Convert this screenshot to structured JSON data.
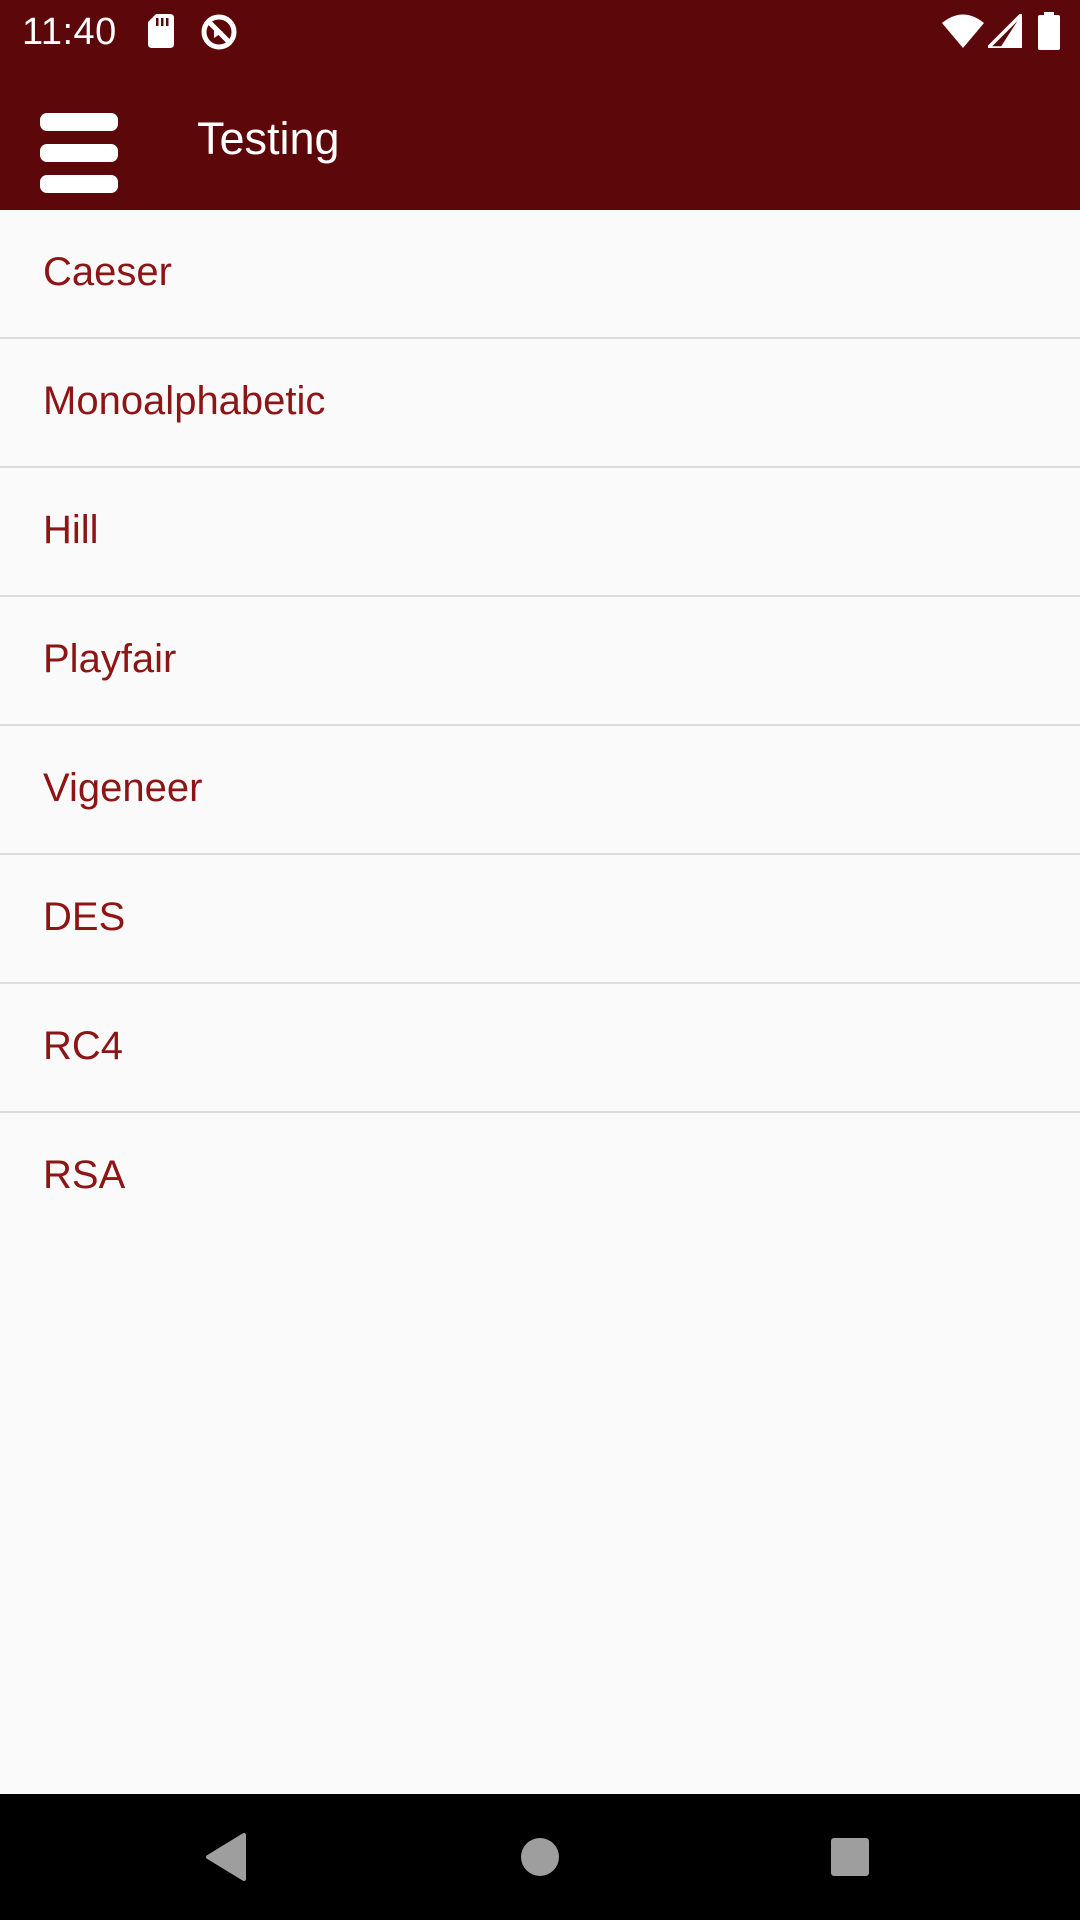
{
  "status_bar": {
    "time": "11:40",
    "icons": [
      "sd-card-icon",
      "sync-disabled-icon",
      "wifi-icon",
      "signal-icon",
      "battery-icon"
    ]
  },
  "app_bar": {
    "title": "Testing",
    "menu_icon": "hamburger-menu-icon",
    "background_color": "#5c080b"
  },
  "list": {
    "items": [
      {
        "label": "Caeser"
      },
      {
        "label": "Monoalphabetic"
      },
      {
        "label": "Hill"
      },
      {
        "label": "Playfair"
      },
      {
        "label": "Vigeneer"
      },
      {
        "label": "DES"
      },
      {
        "label": "RC4"
      },
      {
        "label": "RSA"
      }
    ],
    "text_color": "#8e1515"
  },
  "nav_bar": {
    "icons": [
      "back-icon",
      "home-icon",
      "recents-icon"
    ]
  }
}
